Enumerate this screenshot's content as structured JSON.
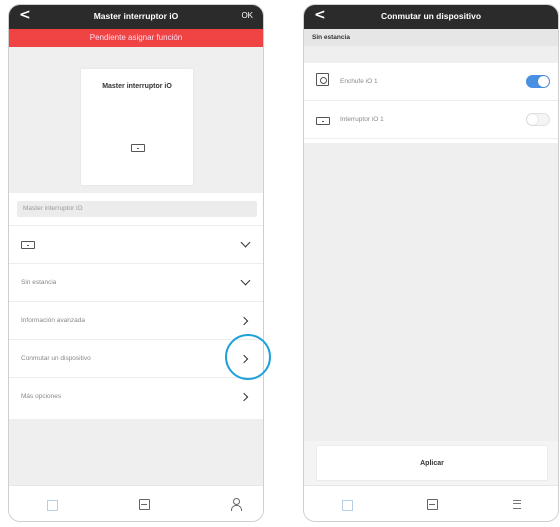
{
  "left": {
    "header": {
      "back": "<",
      "title": "Master interruptor iO",
      "ok": "OK"
    },
    "banner": "Pendiente asignar función",
    "preview": {
      "title": "Master interruptor iO"
    },
    "name_field": {
      "value": "Master interruptor iO"
    },
    "rows": [
      {
        "label": ""
      },
      {
        "label": "Sin estancia"
      },
      {
        "label": "Información avanzada"
      },
      {
        "label": "Conmutar un dispositivo"
      },
      {
        "label": "Más opciones"
      }
    ]
  },
  "right": {
    "header": {
      "back": "<",
      "title": "Conmutar un dispositivo"
    },
    "section": "Sin estancia",
    "devices": [
      {
        "label": "Enchufe iO 1",
        "on": true
      },
      {
        "label": "Interruptor iO 1",
        "on": false
      }
    ],
    "apply_label": "Aplicar"
  },
  "colors": {
    "titlebar": "#2b2b2b",
    "banner": "#f04343",
    "toggle_on": "#4a90e2",
    "highlight": "#1fa2d8"
  },
  "icons": {
    "tab_home": "home-icon",
    "tab_devices": "device-box-icon",
    "tab_user": "user-icon",
    "tab_menu": "menu-icon"
  }
}
